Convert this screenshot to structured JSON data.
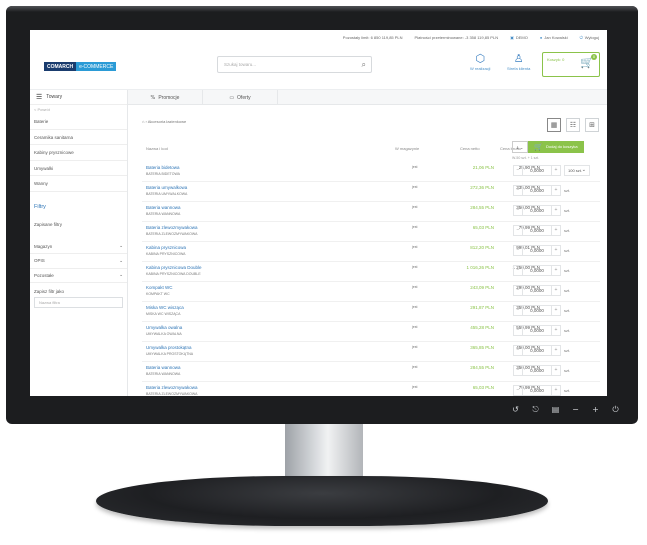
{
  "topbar": {
    "limit": "Pozostały limit: 6 850 119,85 PLN",
    "overdue": "Płatności przeterminowane: -3 358 119,85 PLN",
    "company": "DEMO",
    "user": "Jan Kowalski",
    "logout": "Wyloguj"
  },
  "logo": {
    "part1": "COMARCH",
    "part2": "e-COMMERCE"
  },
  "search": {
    "placeholder": "Szukaj towaru..."
  },
  "header": {
    "items_label": "W realizacji",
    "client_label": "Strefa klienta"
  },
  "cart": {
    "label": "Koszyk: 0",
    "badge": "0"
  },
  "sidebar": {
    "title": "Towary",
    "back": "< Powrót",
    "categories": [
      "Baterie",
      "Ceramika sanitarna",
      "Kabiny prysznicowe",
      "Umywalki",
      "Wanny"
    ],
    "filters_title": "Filtry",
    "saved_filters": "Zapisane filtry",
    "filter_groups": [
      "Magazyn",
      "OPIS",
      "Pozostałe"
    ],
    "save_label": "Zapisz filtr jako",
    "save_placeholder": "Nazwa filtra"
  },
  "tabs": [
    {
      "label": "Promocje",
      "icon": "percent-icon"
    },
    {
      "label": "Oferty",
      "icon": "book-icon"
    }
  ],
  "breadcrumb": "Akcesoria łazienkowe",
  "table": {
    "headers": {
      "name": "Nazwa i kod",
      "stock": "W magazynie",
      "net": "Cena netto",
      "gross": "Cena brutto"
    },
    "qty": "1",
    "add_label": "Dodaj do koszyka",
    "subheader": "W-50 szt. + 1 szt.",
    "rows": [
      {
        "name": "Bateria bidetowa",
        "code": "BATERIA BIDETOWA",
        "unit": "jest",
        "net": "21,06 PLN",
        "gross": "25,90 PLN",
        "qty": "0,0000",
        "uom": "100 szt."
      },
      {
        "name": "Bateria umywalkowa",
        "code": "BATERIA UMYWALKOWA",
        "unit": "jest",
        "net": "272,36 PLN",
        "gross": "335,00 PLN",
        "qty": "0,0000",
        "uom": "szt."
      },
      {
        "name": "Bateria wannowa",
        "code": "BATERIA WANNOWA",
        "unit": "jest",
        "net": "284,55 PLN",
        "gross": "350,00 PLN",
        "qty": "0,0000",
        "uom": "szt."
      },
      {
        "name": "Bateria zlewozmywakowa",
        "code": "BATERIA ZLEWOZMYWAKOWA",
        "unit": "jest",
        "net": "65,03 PLN",
        "gross": "79,99 PLN",
        "qty": "0,0000",
        "uom": "szt."
      },
      {
        "name": "Kabina prysznicowa",
        "code": "KABINA PRYSZNICOWA",
        "unit": "jest",
        "net": "812,20 PLN",
        "gross": "999,01 PLN",
        "qty": "0,0000",
        "uom": "szt."
      },
      {
        "name": "Kabina prysznicowa Double",
        "code": "KABINA PRYSZNICOWA DOUBLE",
        "unit": "jest",
        "net": "1 016,26 PLN",
        "gross": "1 250,00 PLN",
        "qty": "0,0000",
        "uom": "szt."
      },
      {
        "name": "Kompakt WC",
        "code": "KOMPAKT WC",
        "unit": "jest",
        "net": "243,09 PLN",
        "gross": "299,00 PLN",
        "qty": "0,0000",
        "uom": "szt."
      },
      {
        "name": "Miska WC wisząca",
        "code": "MISKA WC WISZĄCA",
        "unit": "jest",
        "net": "291,87 PLN",
        "gross": "359,00 PLN",
        "qty": "0,0000",
        "uom": "szt."
      },
      {
        "name": "Umywalka owalna",
        "code": "UMYWALKA OWALNA",
        "unit": "jest",
        "net": "455,28 PLN",
        "gross": "559,99 PLN",
        "qty": "0,0000",
        "uom": "szt."
      },
      {
        "name": "Umywalka prostokątna",
        "code": "UMYWALKA PROSTOKĄTNA",
        "unit": "jest",
        "net": "365,85 PLN",
        "gross": "450,00 PLN",
        "qty": "0,0000",
        "uom": "szt."
      },
      {
        "name": "Bateria wannowa",
        "code": "BATERIA WANNOWA",
        "unit": "jest",
        "net": "284,55 PLN",
        "gross": "350,00 PLN",
        "qty": "0,0000",
        "uom": "szt."
      },
      {
        "name": "Bateria zlewozmywakowa",
        "code": "BATERIA ZLEWOZMYWAKOWA",
        "unit": "jest",
        "net": "65,03 PLN",
        "gross": "79,99 PLN",
        "qty": "0,0000",
        "uom": "szt."
      }
    ]
  },
  "colors": {
    "accent": "#8bc34a",
    "link": "#2e75b6",
    "brand_dark": "#1a3c6e",
    "brand_light": "#2b9bd6"
  }
}
